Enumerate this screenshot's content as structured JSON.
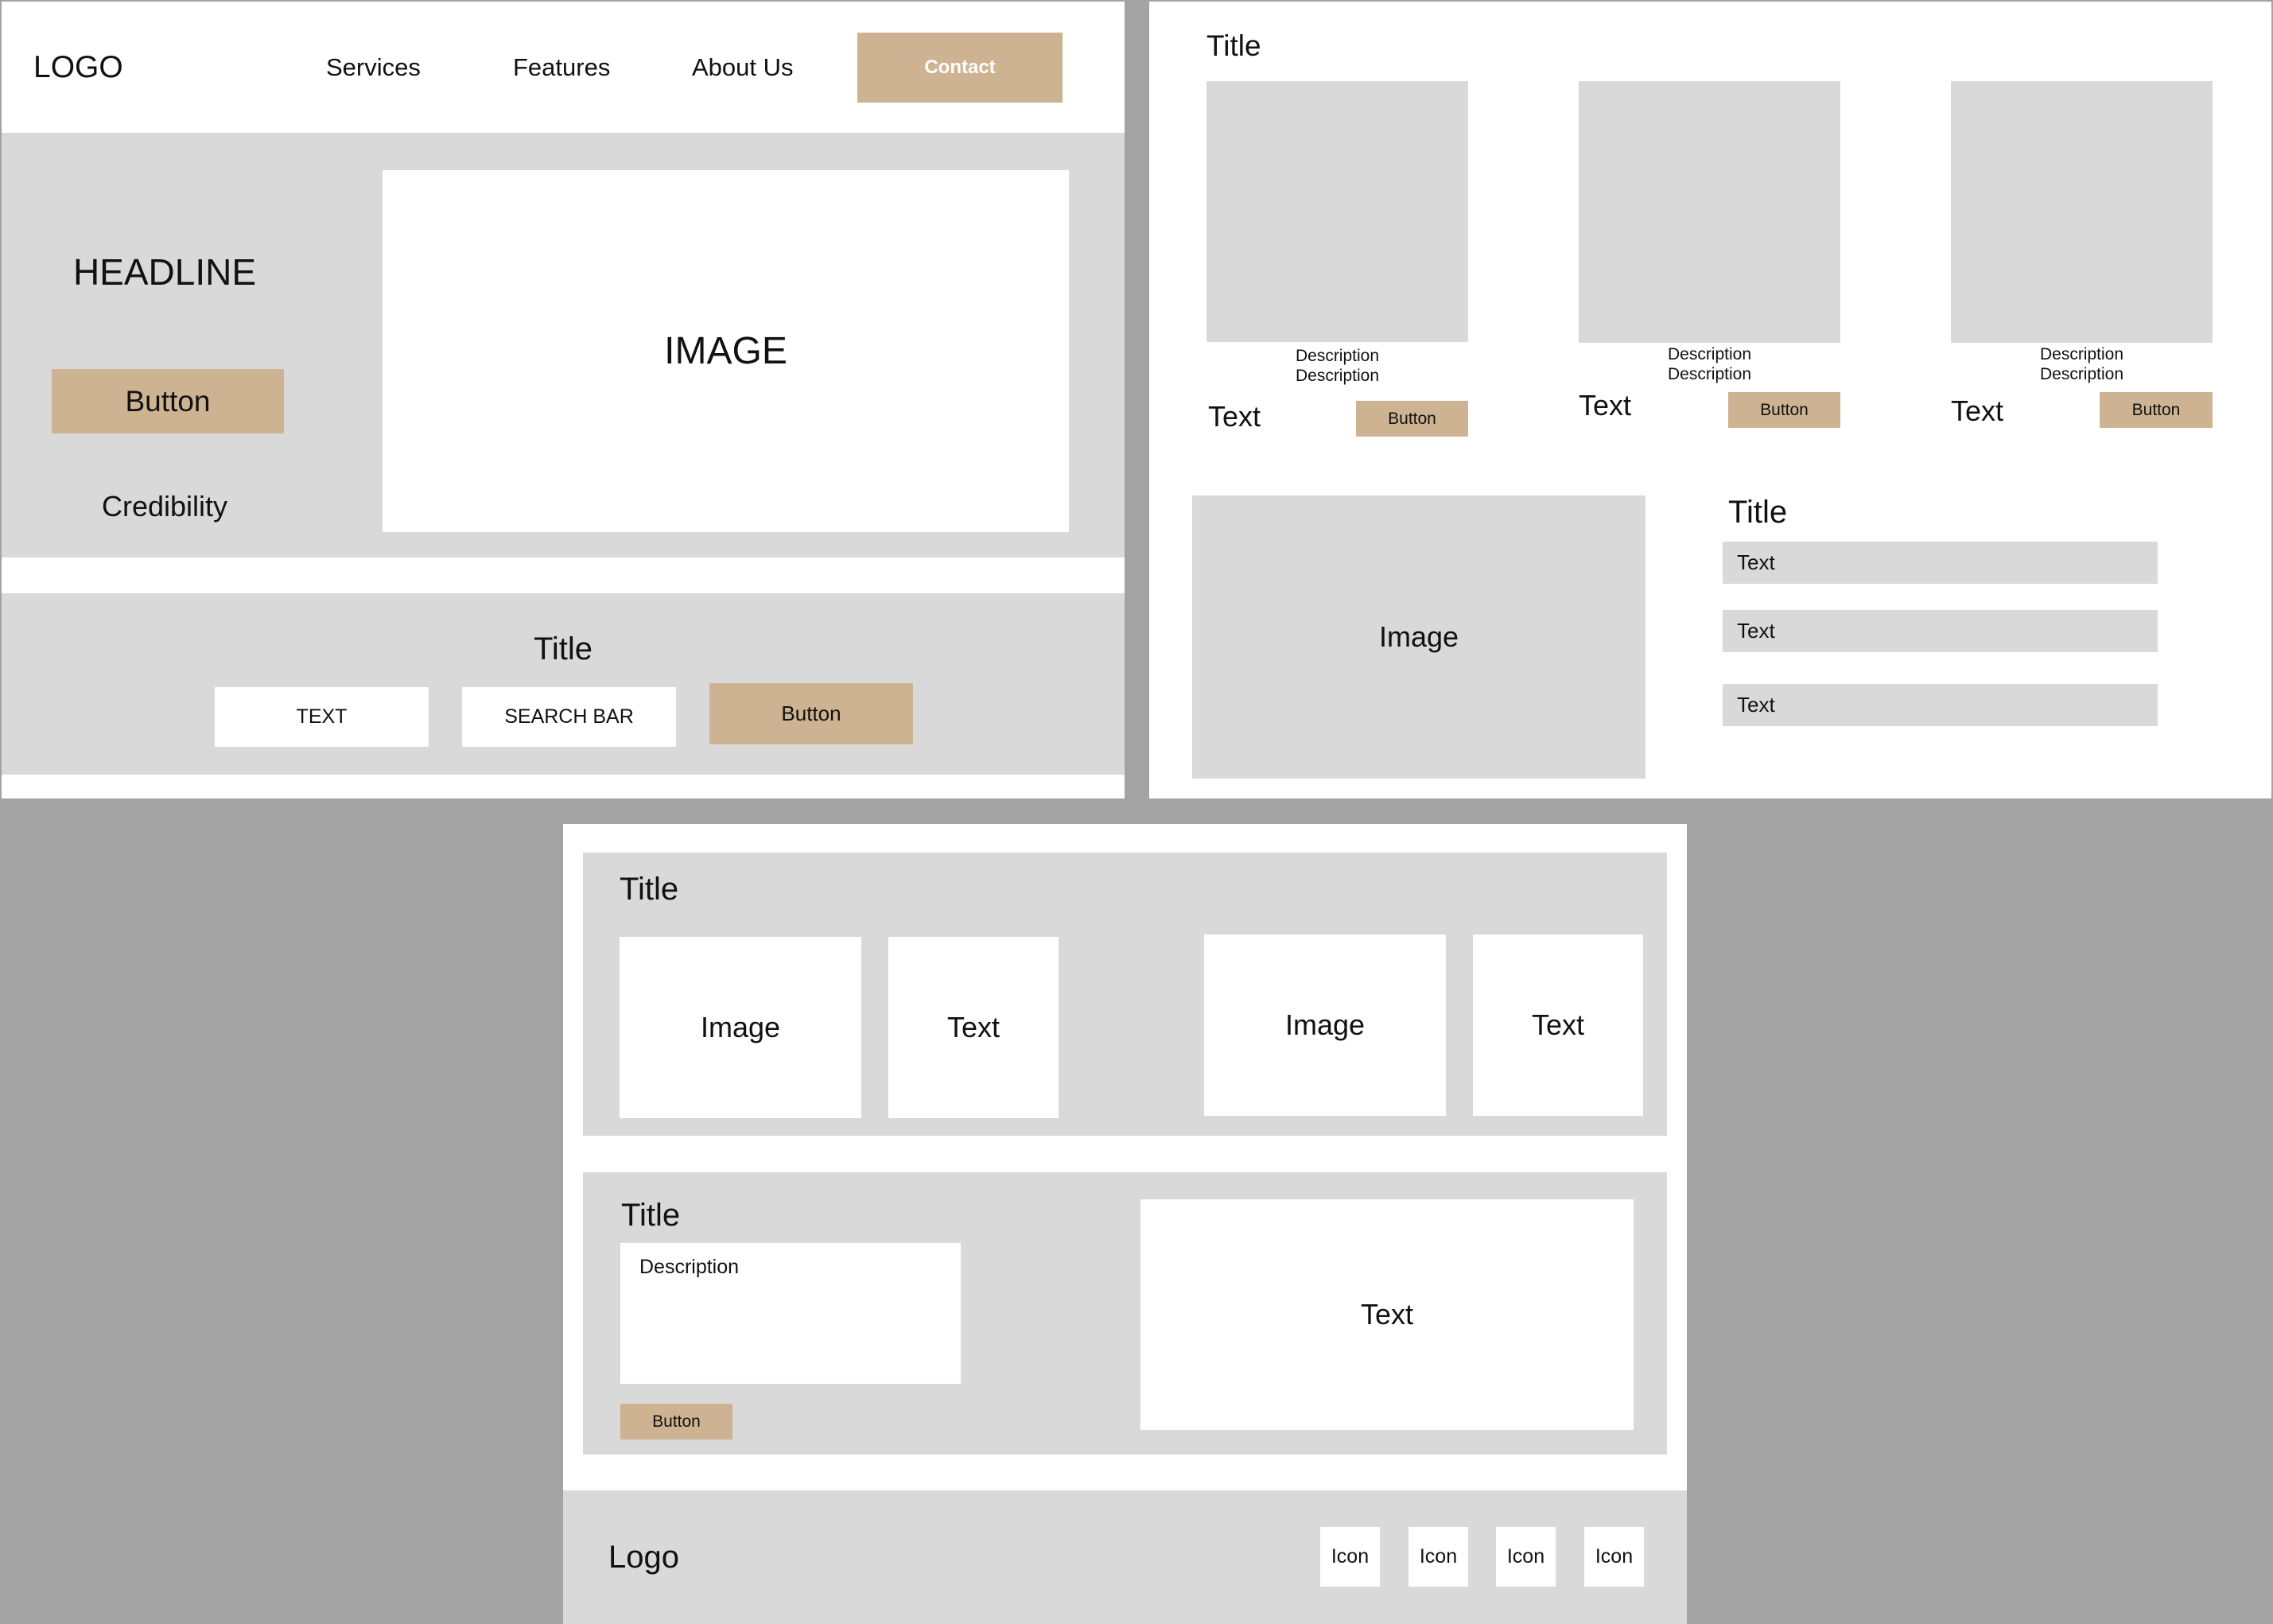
{
  "frame1": {
    "nav": {
      "logo": "LOGO",
      "services": "Services",
      "features": "Features",
      "about": "About Us",
      "contact": "Contact"
    },
    "hero": {
      "headline": "HEADLINE",
      "button": "Button",
      "credibility": "Credibility",
      "image": "IMAGE"
    },
    "search": {
      "title": "Title",
      "text_field": "TEXT",
      "search_field": "SEARCH BAR",
      "button": "Button"
    }
  },
  "frame2": {
    "title": "Title",
    "cards": [
      {
        "desc1": "Description",
        "desc2": "Description",
        "text": "Text",
        "button": "Button"
      },
      {
        "desc1": "Description",
        "desc2": "Description",
        "text": "Text",
        "button": "Button"
      },
      {
        "desc1": "Description",
        "desc2": "Description",
        "text": "Text",
        "button": "Button"
      }
    ],
    "feature": {
      "image": "Image",
      "title": "Title",
      "rows": [
        "Text",
        "Text",
        "Text"
      ]
    }
  },
  "frame3": {
    "gallery": {
      "title": "Title",
      "items": [
        {
          "image": "Image",
          "text": "Text"
        },
        {
          "image": "Image",
          "text": "Text"
        }
      ]
    },
    "info": {
      "title": "Title",
      "description": "Description",
      "button": "Button",
      "text": "Text"
    },
    "footer": {
      "logo": "Logo",
      "icons": [
        "Icon",
        "Icon",
        "Icon",
        "Icon"
      ]
    }
  },
  "colors": {
    "background": "#a3a3a3",
    "panel": "#d9d9d9",
    "accent": "#cdb391",
    "surface": "#ffffff"
  }
}
